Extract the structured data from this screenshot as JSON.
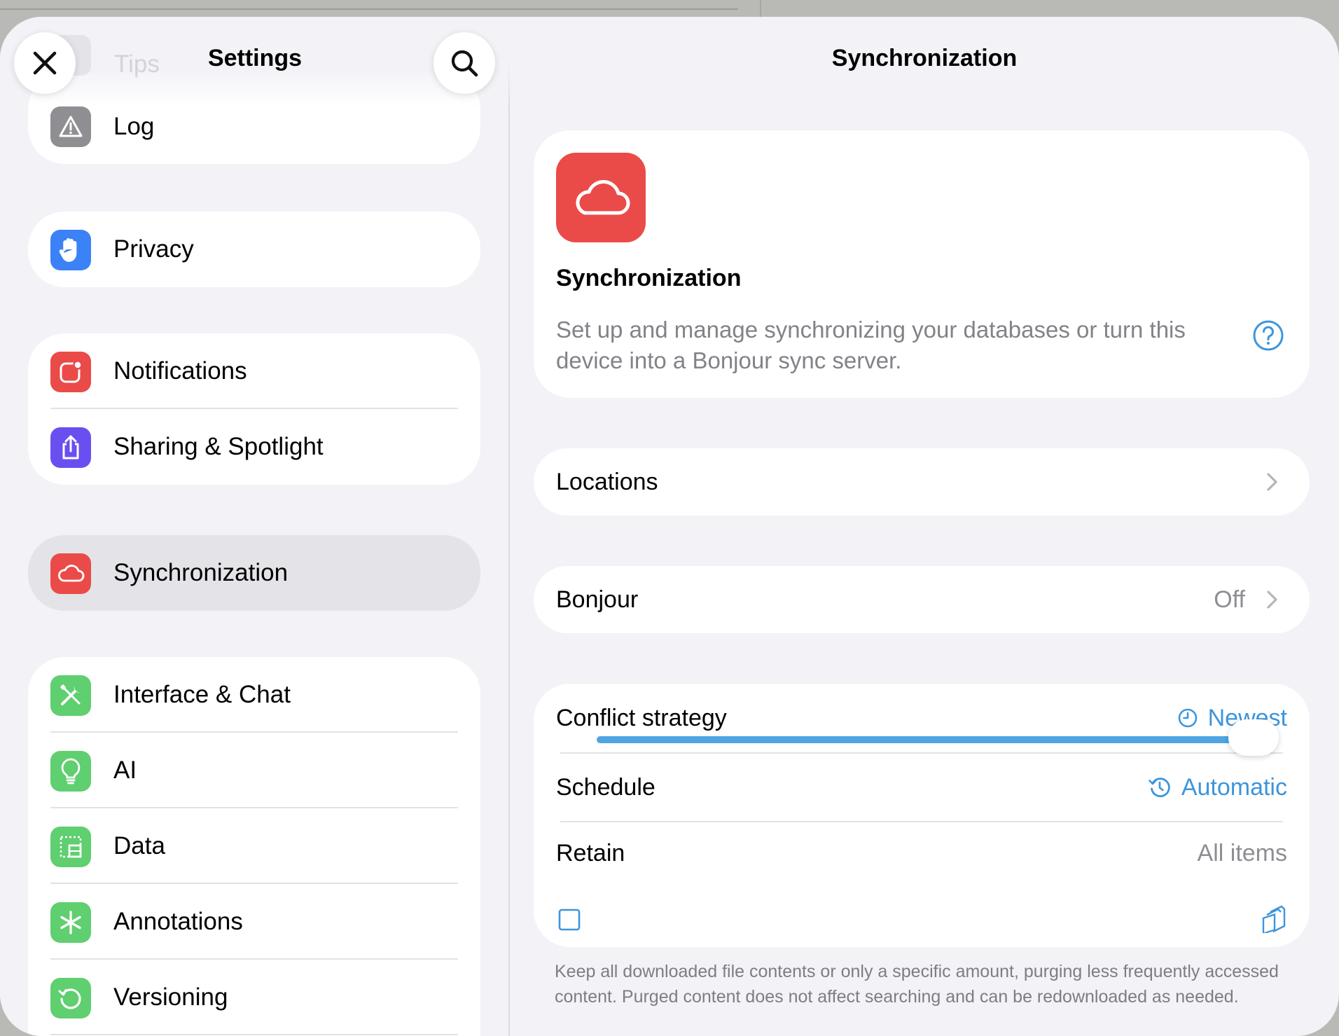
{
  "sidebar": {
    "title": "Settings",
    "ghost_item": {
      "label": "Tips"
    },
    "sections": [
      {
        "items": [
          {
            "label": "Log",
            "icon": "warning-icon",
            "color": "#8e8e93"
          }
        ]
      },
      {
        "items": [
          {
            "label": "Privacy",
            "icon": "hand-icon",
            "color": "#3b82f6"
          }
        ]
      },
      {
        "items": [
          {
            "label": "Notifications",
            "icon": "notification-badge-icon",
            "color": "#ea4b48"
          },
          {
            "label": "Sharing & Spotlight",
            "icon": "share-icon",
            "color": "#6a4ff0"
          }
        ]
      },
      {
        "items": [
          {
            "label": "Synchronization",
            "icon": "cloud-icon",
            "color": "#ea4b48",
            "selected": true
          }
        ]
      },
      {
        "items": [
          {
            "label": "Interface & Chat",
            "icon": "tools-icon",
            "color": "#5fcf70"
          },
          {
            "label": "AI",
            "icon": "lightbulb-icon",
            "color": "#5fcf70"
          },
          {
            "label": "Data",
            "icon": "data-grid-icon",
            "color": "#5fcf70"
          },
          {
            "label": "Annotations",
            "icon": "asterisk-icon",
            "color": "#5fcf70"
          },
          {
            "label": "Versioning",
            "icon": "history-icon",
            "color": "#5fcf70"
          }
        ]
      }
    ]
  },
  "detail": {
    "title": "Synchronization",
    "hero": {
      "title": "Synchronization",
      "description": "Set up and manage synchronizing your databases or turn this device into a Bonjour sync server."
    },
    "locations": {
      "label": "Locations"
    },
    "bonjour": {
      "label": "Bonjour",
      "value": "Off"
    },
    "conflict_strategy": {
      "label": "Conflict strategy",
      "value": "Newest"
    },
    "schedule": {
      "label": "Schedule",
      "value": "Automatic"
    },
    "retain": {
      "label": "Retain",
      "value": "All items",
      "slider_value": 1.0
    },
    "footnote": "Keep all downloaded file contents or only a specific amount, purging less frequently accessed content. Purged content does not affect searching and can be redownloaded as needed."
  },
  "colors": {
    "accent": "#3d95db",
    "sync_red": "#ea4b48",
    "green": "#5fcf70",
    "background": "#f2f2f7"
  }
}
